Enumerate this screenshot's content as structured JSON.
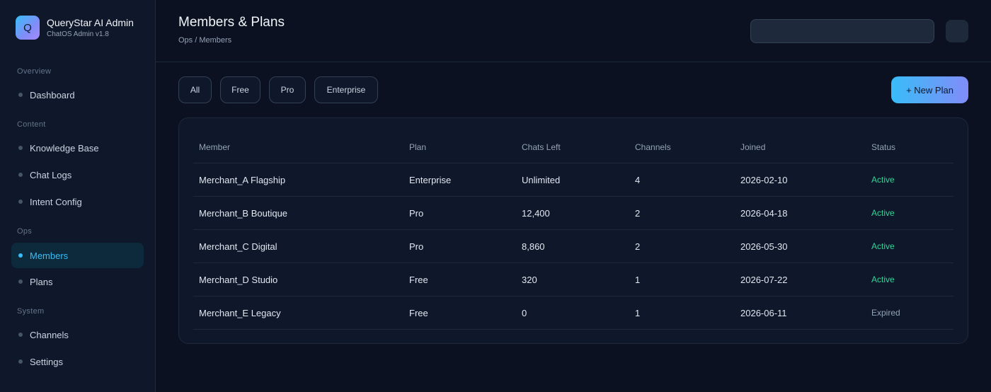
{
  "brand": {
    "logo_letter": "Q",
    "title": "QueryStar AI Admin",
    "subtitle": "ChatOS Admin v1.8"
  },
  "sidebar": {
    "groups": [
      {
        "label": "Overview",
        "items": [
          {
            "label": "Dashboard"
          }
        ]
      },
      {
        "label": "Content",
        "items": [
          {
            "label": "Knowledge Base"
          },
          {
            "label": "Chat Logs"
          },
          {
            "label": "Intent Config"
          }
        ]
      },
      {
        "label": "Ops",
        "items": [
          {
            "label": "Members",
            "active": true
          },
          {
            "label": "Plans"
          }
        ]
      },
      {
        "label": "System",
        "items": [
          {
            "label": "Channels"
          },
          {
            "label": "Settings"
          }
        ]
      }
    ]
  },
  "header": {
    "title": "Members & Plans",
    "breadcrumb": "Ops / Members",
    "search_value": "",
    "search_placeholder": ""
  },
  "filters": [
    "All",
    "Free",
    "Pro",
    "Enterprise"
  ],
  "actions": {
    "new_plan": "+ New Plan"
  },
  "table": {
    "columns": [
      "Member",
      "Plan",
      "Chats Left",
      "Channels",
      "Joined",
      "Status"
    ],
    "rows": [
      {
        "member": "Merchant_A Flagship",
        "plan": "Enterprise",
        "chats_left": "Unlimited",
        "channels": "4",
        "joined": "2026-02-10",
        "status": "Active"
      },
      {
        "member": "Merchant_B Boutique",
        "plan": "Pro",
        "chats_left": "12,400",
        "channels": "2",
        "joined": "2026-04-18",
        "status": "Active"
      },
      {
        "member": "Merchant_C Digital",
        "plan": "Pro",
        "chats_left": "8,860",
        "channels": "2",
        "joined": "2026-05-30",
        "status": "Active"
      },
      {
        "member": "Merchant_D Studio",
        "plan": "Free",
        "chats_left": "320",
        "channels": "1",
        "joined": "2026-07-22",
        "status": "Active"
      },
      {
        "member": "Merchant_E Legacy",
        "plan": "Free",
        "chats_left": "0",
        "channels": "1",
        "joined": "2026-06-11",
        "status": "Expired"
      }
    ]
  },
  "colors": {
    "accent": "#38bdf8",
    "accent_gradient_end": "#818cf8",
    "status_active": "#34d399",
    "status_expired": "#94a3b8",
    "background": "#0b1120",
    "panel": "#0f172a"
  }
}
